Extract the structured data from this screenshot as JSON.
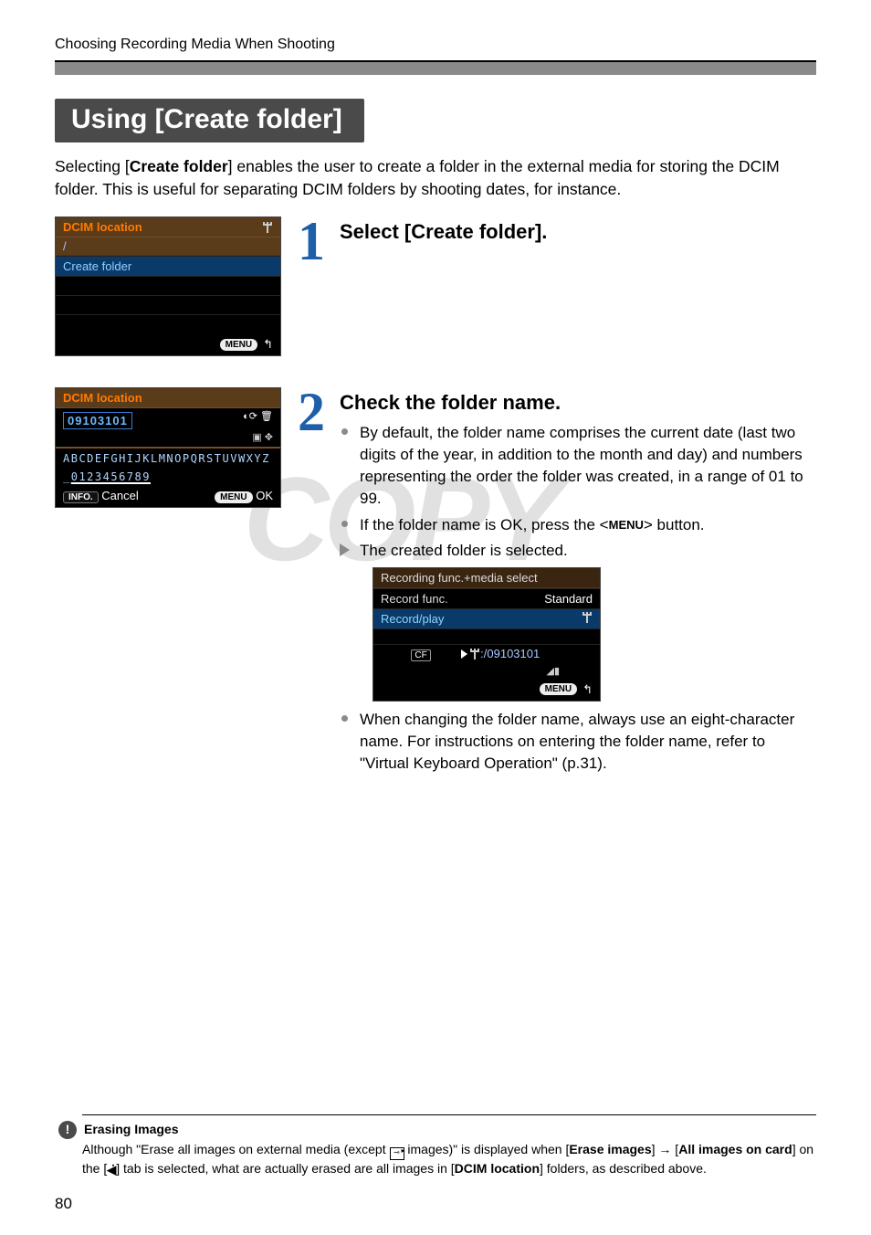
{
  "breadcrumb": "Choosing Recording Media When Shooting",
  "section_title": "Using [Create folder]",
  "intro_parts": {
    "a": "Selecting [",
    "b": "Create folder",
    "c": "] enables the user to create a folder in the external media for storing the DCIM folder. This is useful for separating DCIM folders by shooting dates, for instance."
  },
  "watermark": "COPY",
  "steps": {
    "one": {
      "number": "1",
      "heading": "Select [Create folder].",
      "shot": {
        "header_label": "DCIM location",
        "usb_name": "usb-drive-icon",
        "path": "/",
        "item": "Create folder",
        "menu_label": "MENU",
        "back_glyph": "↰"
      }
    },
    "two": {
      "number": "2",
      "heading": "Check the folder name.",
      "bullets": [
        "By default, the folder name comprises the current date (last two digits of the year, in addition to the month and day) and numbers representing the order the folder was created, in a range of 01 to 99.",
        "If the folder name is OK, press the <MENU> button.",
        "The created folder is selected."
      ],
      "post_bullet": "When changing the folder name, always use an eight-character name. For instructions on entering the folder name, refer to \"Virtual Keyboard Operation\" (p.31).",
      "shot_edit": {
        "header_label": "DCIM location",
        "name_value": "09103101",
        "alpha_row1": "ABCDEFGHIJKLMNOPQRSTUVWXYZ",
        "alpha_row2_underscore": "_",
        "alpha_row2_digits": "0123456789",
        "info_label": "INFO.",
        "cancel_label": "Cancel",
        "menu_label": "MENU",
        "ok_label": "OK"
      },
      "shot_record": {
        "header": "Recording func.+media select",
        "row1_label": "Record func.",
        "row1_value": "Standard",
        "row2_label": "Record/play",
        "row2_value_name": "usb-drive-icon",
        "cf_label": "CF",
        "path_value": ":/09103101",
        "sub_icon_name": "signal-icon",
        "menu_label": "MENU",
        "back_glyph": "↰"
      }
    }
  },
  "note": {
    "title": "Erasing Images",
    "body_parts": {
      "a": "Although \"Erase all images on external media (except ",
      "protect_icon_name": "protect-key-icon",
      "b": " images)\" is displayed when [",
      "c": "Erase images",
      "d": "] → [",
      "e": "All images on card",
      "f": "] on the [",
      "tab_icon_name": "playback-tab-icon",
      "g": "] tab is selected, what are actually erased are all images in [",
      "h": "DCIM location",
      "i": "] folders, as described above."
    }
  },
  "page_number": "80"
}
